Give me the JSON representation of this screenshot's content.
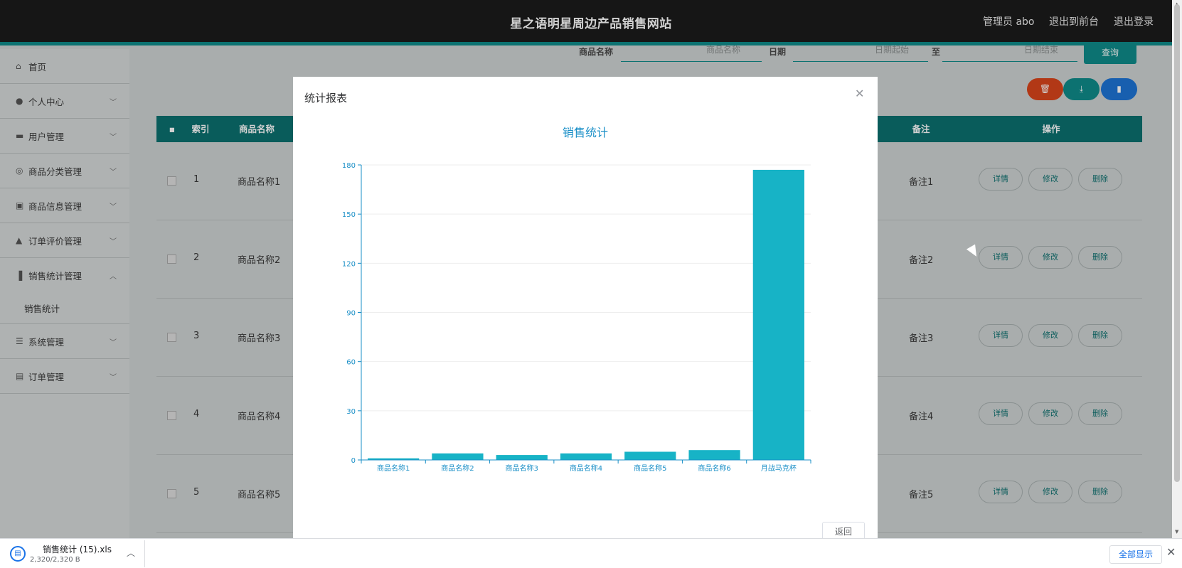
{
  "header": {
    "title": "星之语明星周边产品销售网站",
    "admin_label": "管理员 abo",
    "to_front": "退出到前台",
    "logout": "退出登录"
  },
  "sidebar": {
    "items": [
      {
        "label": "首页",
        "icon": "home-icon"
      },
      {
        "label": "个人中心",
        "icon": "user-icon"
      },
      {
        "label": "用户管理",
        "icon": "chat-icon"
      },
      {
        "label": "商品分类管理",
        "icon": "target-icon"
      },
      {
        "label": "商品信息管理",
        "icon": "briefcase-icon"
      },
      {
        "label": "订单评价管理",
        "icon": "thumbs-up-icon"
      },
      {
        "label": "销售统计管理",
        "icon": "bar-chart-icon"
      },
      {
        "label": "系统管理",
        "icon": "sliders-icon"
      },
      {
        "label": "订单管理",
        "icon": "doc-icon"
      }
    ],
    "sub_item": "销售统计"
  },
  "filters": {
    "name_label": "商品名称",
    "name_placeholder": "商品名称",
    "date_label": "日期",
    "date_start": "日期起始",
    "to_label": "至",
    "date_end": "日期结束",
    "query": "查询"
  },
  "table": {
    "headers": [
      "索引",
      "商品名称",
      "备注",
      "操作"
    ],
    "rows": [
      {
        "index": "1",
        "name": "商品名称1",
        "note": "备注1"
      },
      {
        "index": "2",
        "name": "商品名称2",
        "note": "备注2"
      },
      {
        "index": "3",
        "name": "商品名称3",
        "note": "备注3"
      },
      {
        "index": "4",
        "name": "商品名称4",
        "note": "备注4"
      },
      {
        "index": "5",
        "name": "商品名称5",
        "note": "备注5"
      }
    ],
    "btn_detail": "详情",
    "btn_edit": "修改",
    "btn_delete": "删除"
  },
  "dialog": {
    "title": "统计报表",
    "back": "返回"
  },
  "chart_data": {
    "type": "bar",
    "title": "销售统计",
    "categories": [
      "商品名称1",
      "商品名称2",
      "商品名称3",
      "商品名称4",
      "商品名称5",
      "商品名称6",
      "月战马克杯"
    ],
    "values": [
      1,
      4,
      3,
      4,
      5,
      6,
      177
    ],
    "ylim": [
      0,
      180
    ],
    "yticks": [
      0,
      30,
      60,
      90,
      120,
      150,
      180
    ],
    "bar_color": "#17b3c6",
    "axis_color": "#1a8fc7",
    "grid": true
  },
  "download": {
    "file_name": "销售统计 (15).xls",
    "file_size": "2,320/2,320 B",
    "show_all": "全部显示"
  },
  "colors": {
    "accent": "#0f8c8a",
    "danger": "#d9451c",
    "primary": "#1e74d6"
  }
}
